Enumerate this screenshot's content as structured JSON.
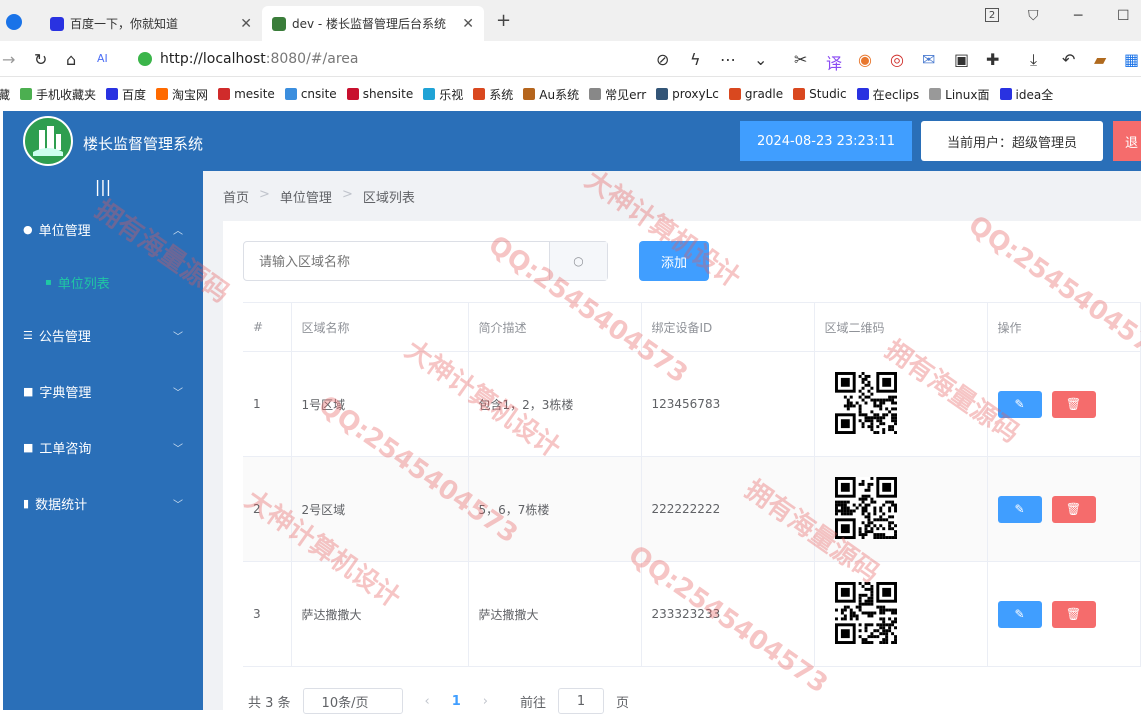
{
  "browser": {
    "tabs": [
      {
        "title": "百度一下，你就知道"
      },
      {
        "title": "dev - 楼长监督管理后台系统"
      }
    ],
    "new_tab": "+",
    "tab_count": "2",
    "url_host": "http://localhost",
    "url_rest": ":8080/#/area",
    "bookmarks": [
      "藏",
      "手机收藏夹",
      "百度",
      "淘宝网",
      "mesite",
      "cnsite",
      "shensite",
      "乐视",
      "系统",
      "Au系统",
      "常见err",
      "proxyLc",
      "gradle",
      "Studic",
      "在eclips",
      "Linux面",
      "idea全"
    ]
  },
  "header": {
    "title": "楼长监督管理系统",
    "datetime": "2024-08-23 23:23:11",
    "current_user": "当前用户：超级管理员",
    "logout": "退"
  },
  "sidebar": {
    "collapse": "|||",
    "menus": [
      {
        "label": "单位管理",
        "icon": "user-icon"
      },
      {
        "label": "公告管理",
        "icon": "sliders-icon"
      },
      {
        "label": "字典管理",
        "icon": "lock-icon"
      },
      {
        "label": "工单咨询",
        "icon": "lock-icon"
      },
      {
        "label": "数据统计",
        "icon": "doc-icon"
      }
    ],
    "submenu": "单位列表"
  },
  "breadcrumb": [
    "首页",
    "单位管理",
    "区域列表"
  ],
  "search": {
    "placeholder": "请输入区域名称"
  },
  "add_button": "添加",
  "table": {
    "headers": [
      "#",
      "区域名称",
      "简介描述",
      "绑定设备ID",
      "区域二维码",
      "操作"
    ],
    "rows": [
      {
        "idx": "1",
        "name": "1号区域",
        "desc": "包含1，2，3栋楼",
        "device": "123456783"
      },
      {
        "idx": "2",
        "name": "2号区域",
        "desc": "5，6，7栋楼",
        "device": "222222222"
      },
      {
        "idx": "3",
        "name": "萨达撒撒大",
        "desc": "萨达撒撒大",
        "device": "233323233"
      }
    ]
  },
  "pagination": {
    "total": "共 3 条",
    "page_size": "10条/页",
    "page": "1",
    "goto": "前往",
    "goto_value": "1",
    "page_suffix": "页"
  },
  "watermarks": [
    "大神计算机设计",
    "QQ:2545404573",
    "拥有海量源码"
  ],
  "colors": {
    "primary": "#409eff",
    "danger": "#f56c6c",
    "sidebar": "#2a6fb8",
    "active_sub": "#1fc7a4"
  }
}
